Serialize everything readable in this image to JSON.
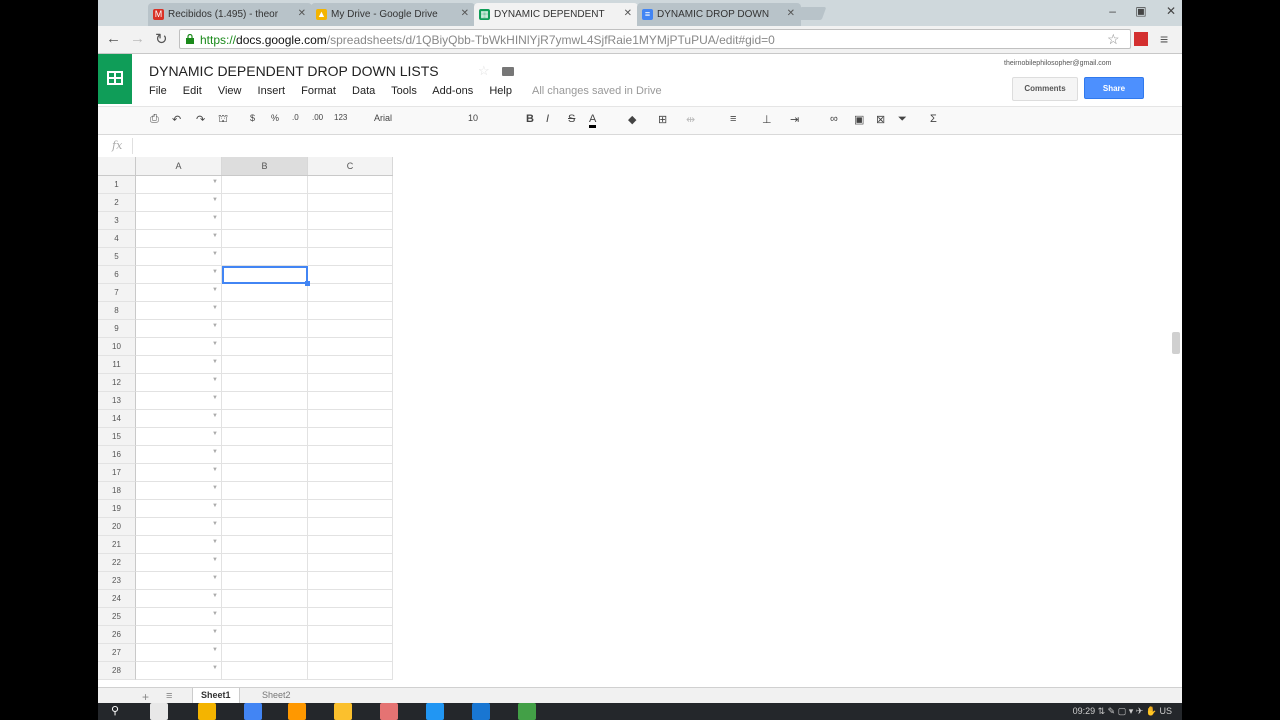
{
  "browser": {
    "tabs": [
      {
        "label": "Recibidos (1.495) - theor",
        "icon": "gmail-icon",
        "color": "#d93025",
        "glyph": "M",
        "active": false
      },
      {
        "label": "My Drive - Google Drive",
        "icon": "drive-icon",
        "color": "#f4b400",
        "glyph": "▲",
        "active": false
      },
      {
        "label": "DYNAMIC DEPENDENT",
        "icon": "sheets-icon",
        "color": "#0f9d58",
        "glyph": "▦",
        "active": true
      },
      {
        "label": "DYNAMIC DROP DOWN",
        "icon": "docs-icon",
        "color": "#4285f4",
        "glyph": "≡",
        "active": false
      }
    ],
    "url_scheme": "https://",
    "url_host": "docs.google.com",
    "url_path": "/spreadsheets/d/1QBiyQbb-TbWkHINlYjR7ymwL4SjfRaie1MYMjPTuPUA/edit#gid=0"
  },
  "doc": {
    "title": "DYNAMIC DEPENDENT DROP DOWN LISTS",
    "account": "theirnobilephilosopher@gmail.com",
    "comments_label": "Comments",
    "share_label": "Share",
    "save_status": "All changes saved in Drive",
    "menu": [
      "File",
      "Edit",
      "View",
      "Insert",
      "Format",
      "Data",
      "Tools",
      "Add-ons",
      "Help"
    ]
  },
  "toolbar": {
    "font": "Arial",
    "size": "10",
    "number_format": "123",
    "percent": "%",
    "decimals_less": ".0",
    "decimals_more": ".00"
  },
  "formula": {
    "fx": "fx"
  },
  "grid": {
    "columns": [
      "A",
      "B",
      "C"
    ],
    "rows": [
      "1",
      "2",
      "3",
      "4",
      "5",
      "6",
      "7",
      "8",
      "9",
      "10",
      "11",
      "12",
      "13",
      "14",
      "15",
      "16",
      "17",
      "18",
      "19",
      "20",
      "21",
      "22",
      "23",
      "24",
      "25",
      "26",
      "27",
      "28"
    ],
    "selected_column": "B",
    "selected_row": "6"
  },
  "sheets": [
    "Sheet1",
    "Sheet2"
  ],
  "os": {
    "time": "09:29",
    "locale": "US"
  },
  "colors": {
    "accent": "#4285f4",
    "sheets_green": "#0f9d58",
    "share_blue": "#4d90fe"
  }
}
